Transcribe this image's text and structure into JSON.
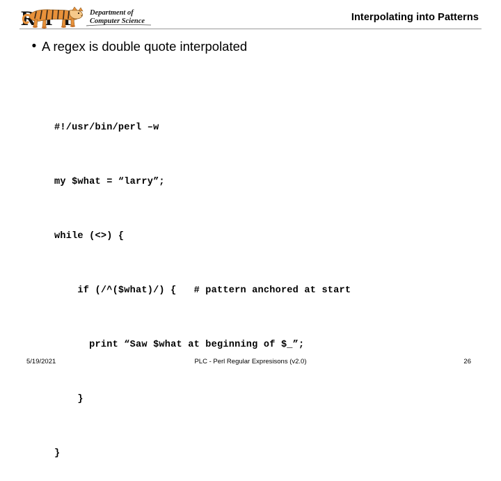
{
  "header": {
    "logo": {
      "institution_initials": "RIT",
      "department_line1": "Department of",
      "department_line2": "Computer Science",
      "tiger_body_color": "#E8913A",
      "tiger_stripe_color": "#3A2A1A",
      "tiger_light_color": "#F6C98A",
      "letter_color": "#111111"
    },
    "title": "Interpolating into Patterns"
  },
  "content": {
    "bullet_marker": "•",
    "bullet_text": "A regex is double quote interpolated",
    "code_lines": [
      "#!/usr/bin/perl –w",
      "my $what = “larry”;",
      "while (<>) {",
      "    if (/^($what)/) {   # pattern anchored at start",
      "      print “Saw $what at beginning of $_”;",
      "    }",
      "}"
    ]
  },
  "footer": {
    "date": "5/19/2021",
    "center_text": "PLC - Perl Regular Expresisons  (v2.0)",
    "page_number": "26"
  }
}
